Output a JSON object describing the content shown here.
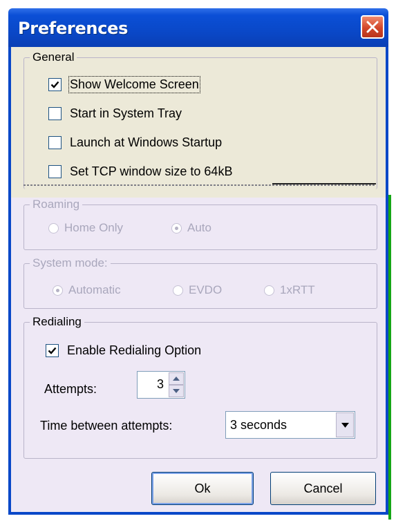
{
  "window": {
    "title": "Preferences"
  },
  "general": {
    "legend": "General",
    "options": [
      {
        "label": "Show Welcome Screen",
        "checked": true
      },
      {
        "label": "Start in System Tray",
        "checked": false
      },
      {
        "label": "Launch at Windows Startup",
        "checked": false
      },
      {
        "label": "Set TCP window size to 64kB",
        "checked": false
      }
    ]
  },
  "roaming": {
    "legend": "Roaming",
    "options": [
      {
        "label": "Home Only",
        "selected": false
      },
      {
        "label": "Auto",
        "selected": true
      }
    ]
  },
  "system_mode": {
    "legend": "System mode:",
    "options": [
      {
        "label": "Automatic",
        "selected": true
      },
      {
        "label": "EVDO",
        "selected": false
      },
      {
        "label": "1xRTT",
        "selected": false
      }
    ]
  },
  "redialing": {
    "legend": "Redialing",
    "enable_label": "Enable Redialing Option",
    "enable_checked": true,
    "attempts_label": "Attempts:",
    "attempts_value": "3",
    "time_label": "Time between attempts:",
    "time_value": "3 seconds"
  },
  "buttons": {
    "ok": "Ok",
    "cancel": "Cancel"
  },
  "icons": {
    "close": "close-icon",
    "check": "checkmark-icon",
    "spin_up": "spin-up-arrow-icon",
    "spin_down": "spin-down-arrow-icon",
    "dropdown": "chevron-down-icon"
  },
  "colors": {
    "title_bar": "#0a48c8",
    "close_button": "#d2462a",
    "dialog_bg": "#eee8f5",
    "general_bg": "#ece9d8",
    "disabled_text": "#a9a7bc"
  }
}
